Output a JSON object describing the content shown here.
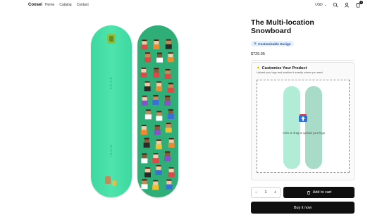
{
  "header": {
    "brand": "Coosei",
    "nav": [
      "Home",
      "Catalog",
      "Contact"
    ],
    "currency": "USD",
    "cart_count": "1"
  },
  "product": {
    "title": "The Multi-location Snowboard",
    "badge": "Customizable Design",
    "price": "$729.95"
  },
  "customizer": {
    "title": "Customize Your Product",
    "subtitle": "Upload your logo and position it exactly where you want",
    "drop_text": "Click or drag to upload your logo"
  },
  "purchase": {
    "qty_minus": "−",
    "quantity": "1",
    "qty_plus": "+",
    "add_to_cart": "Add to cart",
    "buy_now": "Buy it now"
  },
  "colors": {
    "board_green": "#4ee4ac",
    "pattern_green": "#2fae78",
    "button_black": "#0f0f0f",
    "badge_blue": "#1a4f9c"
  }
}
